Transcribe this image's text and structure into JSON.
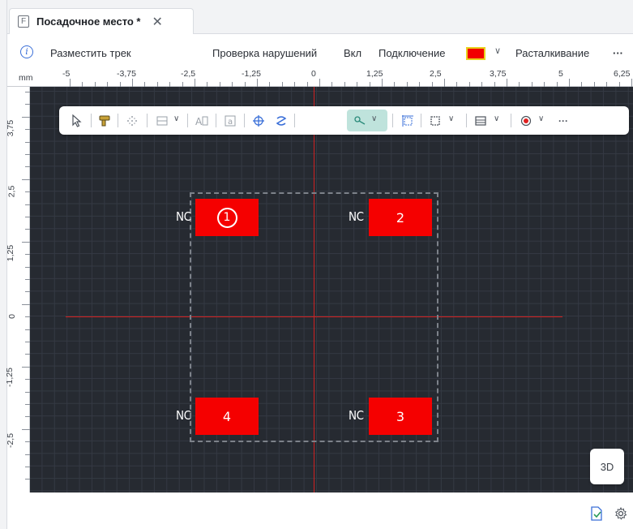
{
  "tab": {
    "file_letter": "F",
    "title": "Посадочное место *",
    "close": "✕"
  },
  "commands": {
    "place_track": "Разместить трек",
    "check_violations": "Проверка нарушений",
    "on": "Вкл",
    "connection": "Подключение",
    "pushing": "Расталкивание",
    "more": "···",
    "accent_color": "#f20000"
  },
  "ruler": {
    "unit": "mm",
    "top_labels": [
      "-5",
      "-3,75",
      "-2,5",
      "-1,25",
      "0",
      "1,25",
      "2,5",
      "3,75",
      "5",
      "6,25"
    ],
    "left_labels": [
      "3,75",
      "2,5",
      "1,25",
      "0",
      "-1,25",
      "-2,5"
    ]
  },
  "toolbar": {
    "items": [
      "select-icon",
      "route-tool-icon",
      "move-icon",
      "grid-icon",
      "text-icon",
      "attribute-icon",
      "origin-icon",
      "snap-icon",
      "measure-icon",
      "dimension-icon",
      "region-icon",
      "layer-icon",
      "pad-icon",
      "more-icon"
    ],
    "more": "···"
  },
  "pads": [
    {
      "number": "1",
      "net": "NC"
    },
    {
      "number": "2",
      "net": "NC"
    },
    {
      "number": "3",
      "net": "NC"
    },
    {
      "number": "4",
      "net": "NC"
    }
  ],
  "view_3d": "3D"
}
